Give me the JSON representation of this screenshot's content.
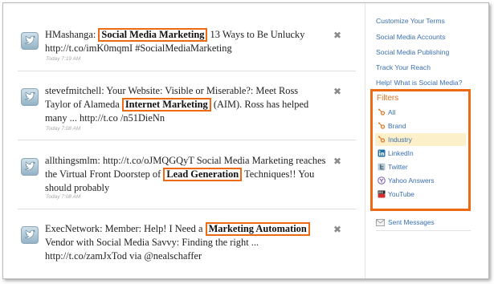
{
  "tweets": [
    {
      "user": "HMashanga",
      "before": ": ",
      "highlight": "Social Media Marketing",
      "after": " 13 Ways to Be Unlucky http://t.co/imK0mqmI #SocialMediaMarketing",
      "time": "Today 7:19 AM"
    },
    {
      "user": "stevefmitchell",
      "before": ": Your Website: Visible or Miserable?: Meet Ross Taylor of Alameda ",
      "highlight": "Internet Marketing",
      "after": " (AIM). Ross has helped many ... http://t.co /n51DieNn",
      "time": "Today 7:08 AM"
    },
    {
      "user": "allthingsmlm",
      "before": ": http://t.co/oJMQGQyT Social Media Marketing reaches the Virtual Front Doorstep of ",
      "highlight": "Lead Generation",
      "after": " Techniques!! You should probably",
      "time": "Today 7:08 AM"
    },
    {
      "user": "ExecNetwork",
      "before": ": Member: Help! I Need a ",
      "highlight": "Marketing Automation",
      "after": " Vendor with Social Media Savvy: Finding the right ... http://t.co/zamJxTod via @nealschaffer",
      "time": "Today 7:08 AM"
    }
  ],
  "close_glyph": "✖",
  "sidebar": {
    "links": [
      "Customize Your Terms",
      "Social Media Accounts",
      "Social Media Publishing",
      "Track Your Reach",
      "Help! What is Social Media?"
    ],
    "filters_title": "Filters",
    "filters": [
      {
        "label": "All",
        "icon": "hubspot-icon"
      },
      {
        "label": "Brand",
        "icon": "hubspot-icon"
      },
      {
        "label": "Industry",
        "icon": "hubspot-icon"
      },
      {
        "label": "LinkedIn",
        "icon": "linkedin-icon"
      },
      {
        "label": "Twitter",
        "icon": "twitter-icon"
      },
      {
        "label": "Yahoo Answers",
        "icon": "yahoo-icon"
      },
      {
        "label": "YouTube",
        "icon": "youtube-icon"
      }
    ],
    "sent_label": "Sent Messages"
  },
  "colors": {
    "highlight_border": "#ec6a13",
    "link": "#3a6fb0",
    "active_filter_bg": "#fbf0c9"
  }
}
